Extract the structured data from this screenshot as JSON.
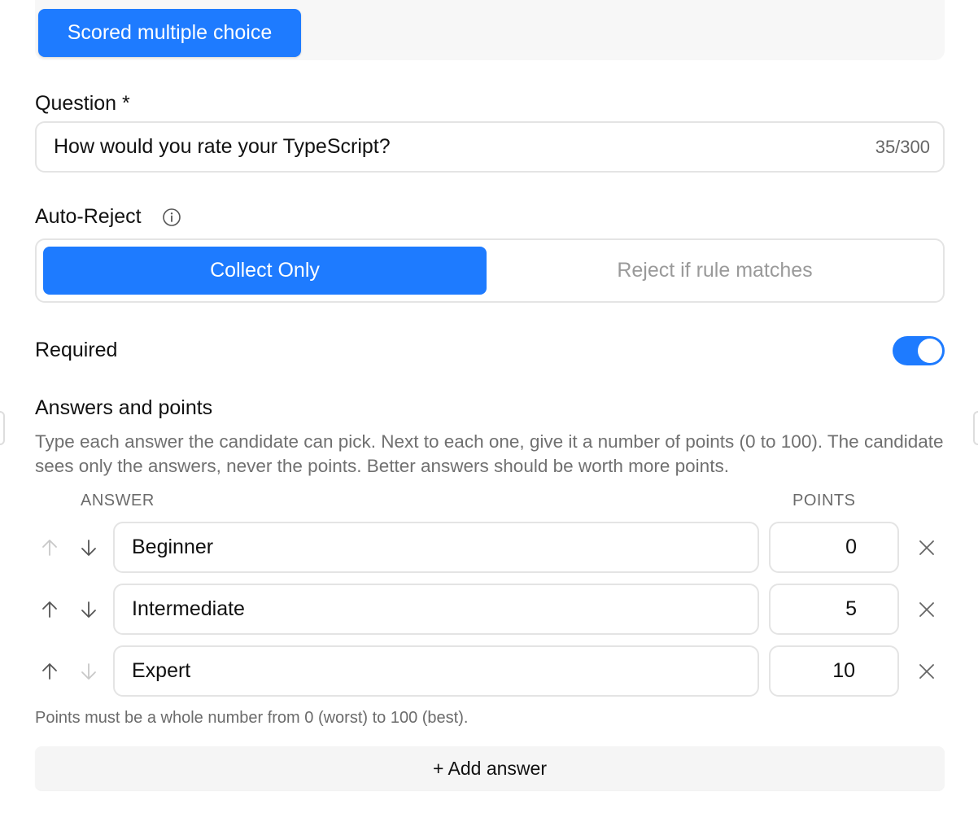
{
  "type_selector": {
    "label": "Scored multiple choice"
  },
  "question": {
    "label": "Question *",
    "value": "How would you rate your TypeScript?",
    "counter": "35/300"
  },
  "auto_reject": {
    "label": "Auto-Reject",
    "info_icon": "info-circle-icon",
    "options": [
      "Collect Only",
      "Reject if rule matches"
    ],
    "selected": "Collect Only"
  },
  "required": {
    "label": "Required",
    "enabled": true
  },
  "answers": {
    "title": "Answers and points",
    "description": "Type each answer the candidate can pick. Next to each one, give it a number of points (0 to 100). The candidate sees only the answers, never the points. Better answers should be worth more points.",
    "col_answer": "ANSWER",
    "col_points": "POINTS",
    "rows": [
      {
        "answer": "Beginner",
        "points": "0",
        "up_enabled": false,
        "down_enabled": true
      },
      {
        "answer": "Intermediate",
        "points": "5",
        "up_enabled": true,
        "down_enabled": true
      },
      {
        "answer": "Expert",
        "points": "10",
        "up_enabled": true,
        "down_enabled": false
      }
    ],
    "hint": "Points must be a whole number from 0 (worst) to 100 (best).",
    "add_label": "+ Add answer"
  },
  "colors": {
    "accent": "#1e7bff",
    "border": "#e4e4e4",
    "muted_text": "#707070",
    "arrow_enabled": "#555555",
    "arrow_disabled": "#c8c8c8"
  }
}
